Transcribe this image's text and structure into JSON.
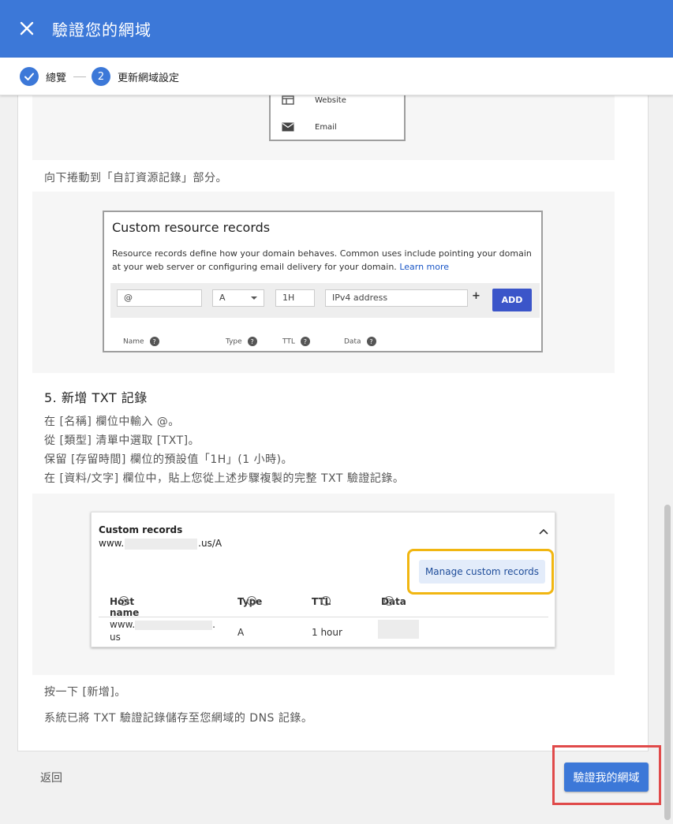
{
  "header": {
    "title": "驗證您的網域",
    "close_icon": "close-icon"
  },
  "stepper": {
    "steps": [
      {
        "label": "總覽",
        "number": "1",
        "done": true
      },
      {
        "label": "更新網域設定",
        "number": "2",
        "done": false
      }
    ]
  },
  "content": {
    "top_menu": {
      "items": [
        "Website",
        "Email"
      ]
    },
    "scroll_text": "向下捲動到「自訂資源記錄」部分。",
    "custom_resource_records": {
      "title": "Custom resource records",
      "description": "Resource records define how your domain behaves. Common uses include pointing your domain at your web server or configuring email delivery for your domain.",
      "learn_more": "Learn more",
      "name_value": "@",
      "type_value": "A",
      "ttl_value": "1H",
      "data_placeholder": "IPv4 address",
      "plus": "+",
      "add_label": "ADD",
      "columns": [
        "Name",
        "Type",
        "TTL",
        "Data"
      ]
    },
    "step5": {
      "title": "5. 新增 TXT 記錄",
      "lines": [
        "在 [名稱] 欄位中輸入 @。",
        "從 [類型] 清單中選取 [TXT]。",
        "保留 [存留時間] 欄位的預設值「1H」(1 小時)。",
        "在 [資料/文字] 欄位中，貼上您從上述步驟複製的完整 TXT 驗證記錄。"
      ]
    },
    "custom_records": {
      "title": "Custom records",
      "domain_prefix": "www.",
      "domain_suffix": ".us/A",
      "manage_label": "Manage custom records",
      "columns": [
        "Host name",
        "Type",
        "TTL",
        "Data"
      ],
      "row": {
        "host_prefix": "www.",
        "host_suffix": ".",
        "host_line2": "us",
        "type": "A",
        "ttl": "1 hour"
      }
    },
    "after_lines": [
      "按一下 [新增]。",
      "系統已將 TXT 驗證記錄儲存至您網域的 DNS 記錄。"
    ]
  },
  "footer": {
    "back_label": "返回",
    "verify_label": "驗證我的網域"
  },
  "colors": {
    "primary": "#3c78d8",
    "highlight_orange": "#f1b611",
    "highlight_red": "#e04a4a",
    "add_button": "#3b55c9"
  }
}
